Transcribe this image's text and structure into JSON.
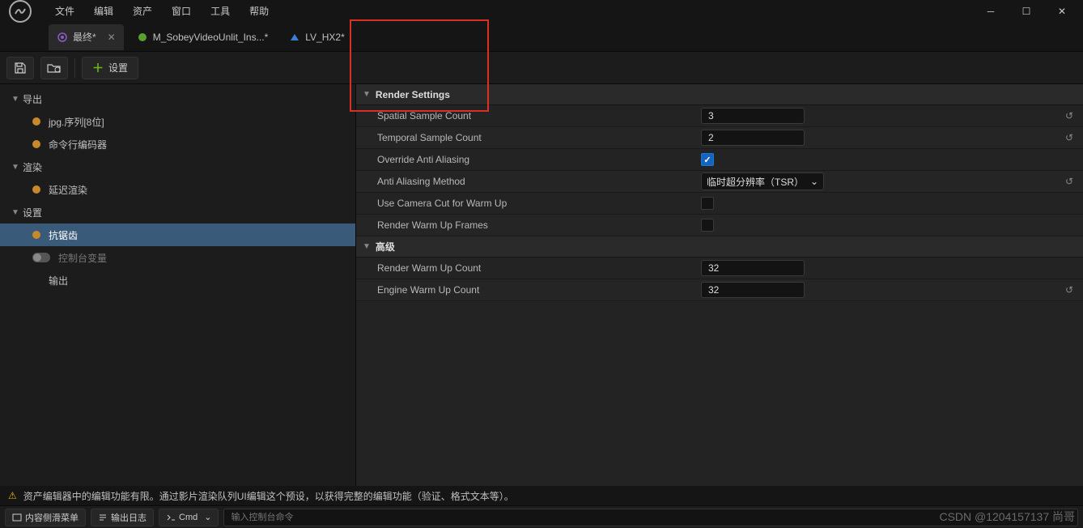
{
  "menu": {
    "items": [
      "文件",
      "编辑",
      "资产",
      "窗口",
      "工具",
      "帮助"
    ]
  },
  "tabs": [
    {
      "label": "最终*",
      "active": true,
      "iconColor": "#8a5cc7"
    },
    {
      "label": "M_SobeyVideoUnlit_Ins...*",
      "active": false,
      "iconColor": "#5aa02c"
    },
    {
      "label": "LV_HX2*",
      "active": false,
      "iconColor": "#3a7fd5"
    }
  ],
  "toolbar": {
    "settings_label": "设置"
  },
  "tree": {
    "export": {
      "label": "导出"
    },
    "export_items": [
      "jpg.序列[8位]",
      "命令行编码器"
    ],
    "render": {
      "label": "渲染"
    },
    "render_items": [
      "延迟渲染"
    ],
    "settings": {
      "label": "设置"
    },
    "settings_items": [
      {
        "label": "抗锯齿",
        "sel": true,
        "dot": true
      },
      {
        "label": "控制台变量",
        "sel": false,
        "toggle": true
      },
      {
        "label": "输出",
        "sel": false
      }
    ]
  },
  "details": {
    "section1": "Render Settings",
    "section2": "高级",
    "rows": {
      "spatial": {
        "label": "Spatial Sample Count",
        "value": "3",
        "reset": true
      },
      "temporal": {
        "label": "Temporal Sample Count",
        "value": "2",
        "reset": true
      },
      "override": {
        "label": "Override Anti Aliasing",
        "checked": true
      },
      "method": {
        "label": "Anti Aliasing Method",
        "value": "临时超分辨率（TSR）",
        "reset": true
      },
      "camcut": {
        "label": "Use Camera Cut for Warm Up",
        "checked": false
      },
      "warmframes": {
        "label": "Render Warm Up Frames",
        "checked": false
      },
      "renderwarm": {
        "label": "Render Warm Up Count",
        "value": "32"
      },
      "enginewarm": {
        "label": "Engine Warm Up Count",
        "value": "32",
        "reset": true
      }
    }
  },
  "warning": "资产编辑器中的编辑功能有限。通过影片渲染队列UI编辑这个预设，以获得完整的编辑功能（验证、格式文本等）。",
  "status": {
    "content_btn": "内容侧滑菜单",
    "log_btn": "输出日志",
    "cmd_label": "Cmd",
    "cmd_placeholder": "输入控制台命令"
  },
  "watermark": "CSDN @1204157137 尚哥"
}
